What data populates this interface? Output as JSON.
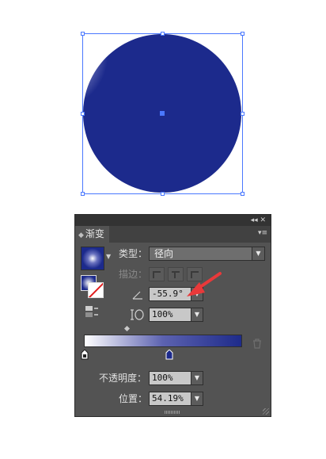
{
  "panel": {
    "title_icons": "◂◂  ✕",
    "tab_label": "渐变",
    "menu_icon": "▾≡",
    "type_label": "类型：",
    "type_value": "径向",
    "stroke_label": "描边：",
    "angle_value": "-55.9°",
    "aspect_value": "100%",
    "opacity_label": "不透明度：",
    "opacity_value": "100%",
    "position_label": "位置：",
    "position_value": "54.19%"
  },
  "gradient": {
    "start_color": "#ffffff",
    "end_color": "#1e2b8a",
    "stop_positions": [
      0,
      54.19
    ]
  },
  "colors": {
    "circle_dark": "#1c2a8c",
    "selection": "#4a78ff",
    "arrow": "#e8393a"
  }
}
